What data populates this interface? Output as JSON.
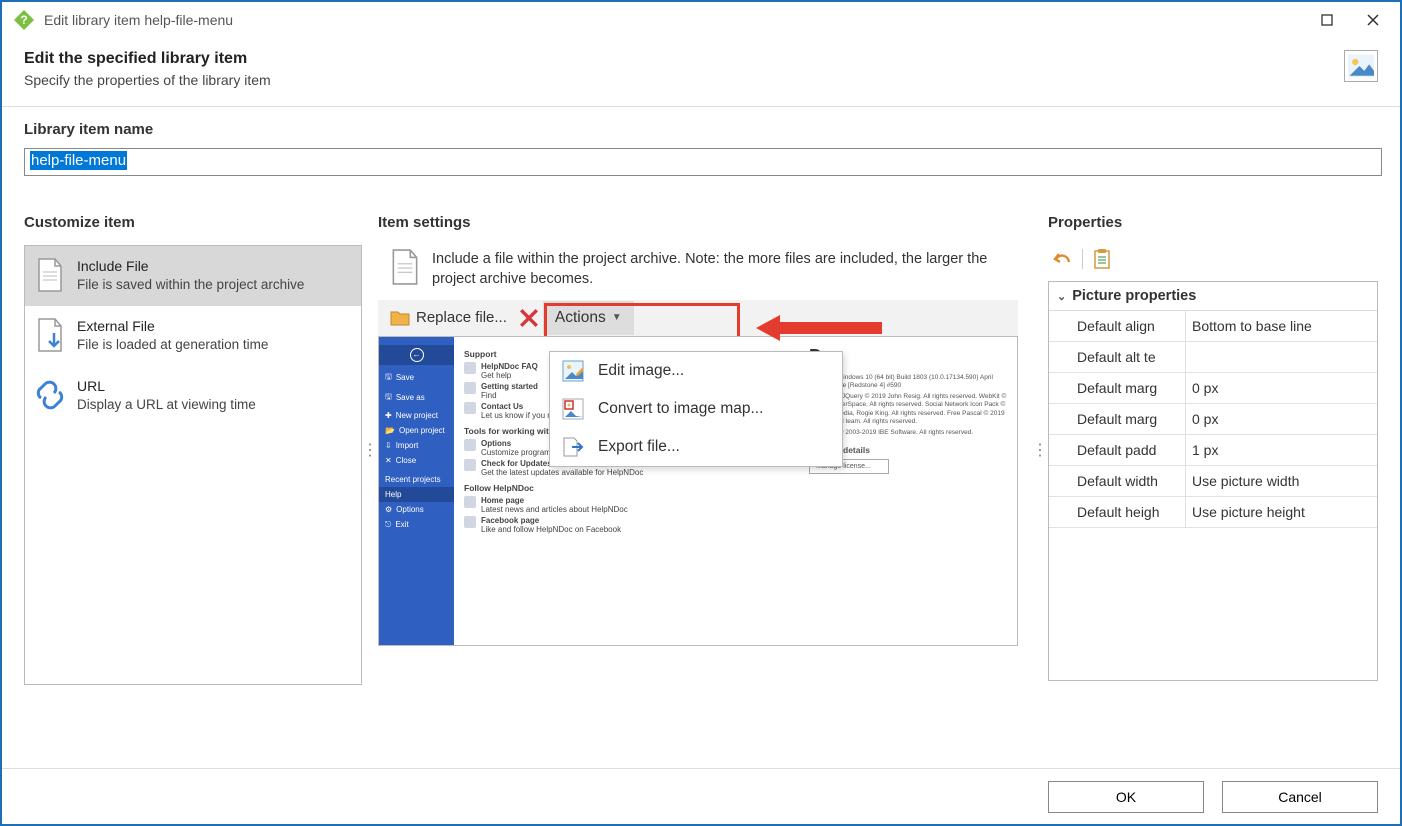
{
  "window": {
    "title": "Edit library item help-file-menu"
  },
  "header": {
    "title": "Edit the specified library item",
    "subtitle": "Specify the properties of the library item"
  },
  "name_section": {
    "label": "Library item name",
    "value": "help-file-menu"
  },
  "customize": {
    "title": "Customize item",
    "items": [
      {
        "title": "Include File",
        "desc": "File is saved within the project archive"
      },
      {
        "title": "External File",
        "desc": "File is loaded at generation time"
      },
      {
        "title": "URL",
        "desc": "Display a URL at viewing time"
      }
    ]
  },
  "settings": {
    "title": "Item settings",
    "desc": "Include a file within the project archive. Note: the more files are included, the larger the project archive becomes.",
    "replace": "Replace file...",
    "actions": "Actions",
    "menu": {
      "edit": "Edit image...",
      "convert": "Convert to image map...",
      "export": "Export file..."
    }
  },
  "preview": {
    "side": [
      "Save",
      "Save as",
      "New project",
      "Open project",
      "Import",
      "Close",
      "Recent projects",
      "Help",
      "Options",
      "Exit"
    ],
    "support_h": "Support",
    "support": [
      {
        "t": "HelpNDoc FAQ",
        "d": "Get help"
      },
      {
        "t": "Getting started",
        "d": "Find"
      },
      {
        "t": "Contact Us",
        "d": "Let us know if you need help or how we can make HelpNDoc better"
      }
    ],
    "tools_h": "Tools for working with HelpNDoc",
    "tools": [
      {
        "t": "Options",
        "d": "Customize program settings"
      },
      {
        "t": "Check for Updates",
        "d": "Get the latest updates available for HelpNDoc"
      }
    ],
    "follow_h": "Follow HelpNDoc",
    "follow": [
      {
        "t": "Home page",
        "d": "Latest news and articles about HelpNDoc"
      },
      {
        "t": "Facebook page",
        "d": "Like and follow HelpNDoc on Facebook"
      }
    ],
    "brand": "Doc",
    "license_h": "License details",
    "manage": "Manage license..."
  },
  "properties": {
    "title": "Properties",
    "group": "Picture properties",
    "rows": [
      {
        "k": "Default align",
        "v": "Bottom to base line"
      },
      {
        "k": "Default alt te",
        "v": ""
      },
      {
        "k": "Default marg",
        "v": "0 px"
      },
      {
        "k": "Default marg",
        "v": "0 px"
      },
      {
        "k": "Default padd",
        "v": "1 px"
      },
      {
        "k": "Default width",
        "v": "Use picture width"
      },
      {
        "k": "Default heigh",
        "v": "Use picture height"
      }
    ]
  },
  "footer": {
    "ok": "OK",
    "cancel": "Cancel"
  }
}
